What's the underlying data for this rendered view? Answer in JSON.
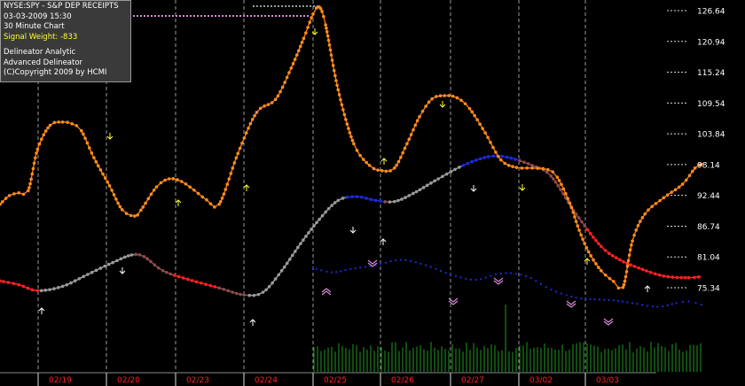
{
  "info": {
    "symbol": "NYSE:SPY - S&P DEP RECEIPTS",
    "datetime": "03-03-2009  15:30",
    "timeframe": "30 Minute Chart",
    "signal_weight": "Signal Weight: -833",
    "line1": "Delineator Analytic",
    "line2": "Advanced Delineator",
    "line3": "(C)Copyright 2009 by  HCMI"
  },
  "colors": {
    "background": "#000000",
    "price": "#ff7f1a",
    "price_dot": "#ff8c1a",
    "delineator_up": "#9a9a9a",
    "delineator_down": "#8b4a4a",
    "delineator_red": "#ff2020",
    "delineator_blue": "#1a2bd6",
    "analytic_blue": "#1a2bd6",
    "volume": "#1f9a1f",
    "date_label": "#ff2020",
    "signal_up": "#ffffff",
    "signal_down": "#ffff33",
    "signal_weight_text": "#ffff33",
    "pink_marker": "#d98ad9",
    "grid": "#9a9a9a"
  },
  "chart_data": {
    "type": "line",
    "title": "NYSE:SPY - S&P DEP RECEIPTS",
    "x_categories": [
      "02/19",
      "02/20",
      "02/23",
      "02/24",
      "02/25",
      "02/26",
      "02/27",
      "03/02",
      "03/03"
    ],
    "ylim": [
      71.5,
      128.0
    ],
    "yticks": [
      126.64,
      120.94,
      115.24,
      109.54,
      103.84,
      98.14,
      92.44,
      86.74,
      81.04,
      75.34
    ],
    "grid": "vertical dotted at session boundaries",
    "price_keypoints": [
      [
        0,
        90.8
      ],
      [
        0.03,
        92.4
      ],
      [
        0.06,
        92.9
      ],
      [
        0.09,
        93.3
      ],
      [
        0.12,
        101.0
      ],
      [
        0.16,
        105.4
      ],
      [
        0.2,
        106.0
      ],
      [
        0.23,
        105.7
      ],
      [
        0.26,
        104.4
      ],
      [
        0.3,
        99.4
      ],
      [
        0.35,
        94.2
      ],
      [
        0.39,
        89.8
      ],
      [
        0.43,
        88.6
      ],
      [
        0.45,
        89.7
      ],
      [
        0.5,
        94.0
      ],
      [
        0.54,
        95.5
      ],
      [
        0.58,
        95.0
      ],
      [
        0.62,
        93.4
      ],
      [
        0.66,
        91.6
      ],
      [
        0.7,
        90.8
      ],
      [
        0.76,
        100.2
      ],
      [
        0.82,
        107.8
      ],
      [
        0.88,
        110.2
      ],
      [
        0.93,
        116.0
      ],
      [
        0.97,
        121.5
      ],
      [
        1.0,
        126.0
      ],
      [
        1.02,
        127.3
      ],
      [
        1.04,
        124.0
      ],
      [
        1.08,
        112.0
      ],
      [
        1.13,
        102.0
      ],
      [
        1.18,
        98.0
      ],
      [
        1.22,
        97.0
      ],
      [
        1.26,
        97.5
      ],
      [
        1.3,
        102.0
      ],
      [
        1.34,
        107.0
      ],
      [
        1.38,
        110.3
      ],
      [
        1.42,
        110.9
      ],
      [
        1.46,
        110.5
      ],
      [
        1.5,
        108.5
      ],
      [
        1.55,
        104.0
      ],
      [
        1.6,
        99.0
      ],
      [
        1.65,
        97.6
      ],
      [
        1.7,
        97.5
      ],
      [
        1.75,
        97.2
      ],
      [
        1.78,
        95.8
      ],
      [
        1.82,
        91.0
      ],
      [
        1.85,
        86.0
      ],
      [
        1.88,
        82.0
      ],
      [
        1.92,
        78.5
      ],
      [
        1.96,
        76.5
      ],
      [
        1.99,
        75.4
      ],
      [
        2.02,
        84.0
      ],
      [
        2.06,
        89.0
      ],
      [
        2.12,
        92.0
      ],
      [
        2.18,
        94.5
      ],
      [
        2.22,
        97.5
      ],
      [
        2.24,
        98.2
      ]
    ],
    "delineator_keypoints": [
      [
        0,
        76.6
      ],
      [
        0.06,
        75.9
      ],
      [
        0.12,
        74.8
      ],
      [
        0.2,
        75.6
      ],
      [
        0.28,
        77.8
      ],
      [
        0.36,
        80.0
      ],
      [
        0.42,
        81.4
      ],
      [
        0.46,
        81.1
      ],
      [
        0.52,
        78.5
      ],
      [
        0.6,
        76.9
      ],
      [
        0.7,
        75.3
      ],
      [
        0.78,
        74.0
      ],
      [
        0.84,
        74.5
      ],
      [
        0.9,
        78.5
      ],
      [
        0.96,
        83.5
      ],
      [
        1.02,
        88.0
      ],
      [
        1.08,
        91.5
      ],
      [
        1.14,
        92.2
      ],
      [
        1.2,
        91.5
      ],
      [
        1.26,
        91.3
      ],
      [
        1.32,
        92.8
      ],
      [
        1.4,
        95.5
      ],
      [
        1.48,
        98.0
      ],
      [
        1.56,
        99.6
      ],
      [
        1.62,
        99.5
      ],
      [
        1.7,
        98.0
      ],
      [
        1.76,
        96.0
      ],
      [
        1.84,
        89.0
      ],
      [
        1.92,
        83.0
      ],
      [
        1.98,
        80.5
      ],
      [
        2.04,
        79.0
      ],
      [
        2.12,
        77.5
      ],
      [
        2.2,
        77.2
      ],
      [
        2.24,
        77.4
      ]
    ],
    "analytic_keypoints": [
      [
        1.0,
        79.0
      ],
      [
        1.06,
        78.2
      ],
      [
        1.12,
        78.8
      ],
      [
        1.2,
        79.5
      ],
      [
        1.28,
        80.5
      ],
      [
        1.36,
        79.5
      ],
      [
        1.44,
        77.8
      ],
      [
        1.52,
        76.8
      ],
      [
        1.6,
        78.0
      ],
      [
        1.68,
        77.5
      ],
      [
        1.76,
        75.0
      ],
      [
        1.84,
        73.5
      ],
      [
        1.9,
        73.2
      ],
      [
        1.96,
        73.0
      ],
      [
        2.02,
        72.5
      ],
      [
        2.1,
        71.8
      ],
      [
        2.16,
        72.5
      ],
      [
        2.2,
        72.8
      ],
      [
        2.24,
        72.2
      ]
    ],
    "volume_range": [
      1.0,
      2.24
    ]
  }
}
